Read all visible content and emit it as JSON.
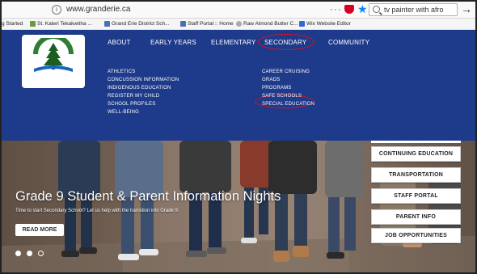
{
  "browser": {
    "url": "www.granderie.ca",
    "search_query": "tv painter with afro",
    "more_dots": "···"
  },
  "bookmarks": [
    {
      "label": "g Started",
      "color": ""
    },
    {
      "label": "St. Kateri Tekakwitha ...",
      "color": "#6a9a3a"
    },
    {
      "label": "Grand Erie District Sch...",
      "color": "#4a6fb3"
    },
    {
      "label": "Staff Portal :: Home",
      "color": "#4a6fb3"
    },
    {
      "label": "Raw Almond Butter C...",
      "color": "#aaaaaa"
    },
    {
      "label": "Wix Website Editor",
      "color": "#2a6bd6"
    }
  ],
  "nav": {
    "about": "ABOUT",
    "early_years": "EARLY YEARS",
    "elementary": "ELEMENTARY",
    "secondary": "SECONDARY",
    "community": "COMMUNITY"
  },
  "submenu_left": [
    "ATHLETICS",
    "CONCUSSION INFORMATION",
    "INDIGENOUS EDUCATION",
    "REGISTER MY CHILD",
    "SCHOOL PROFILES",
    "WELL-BEING"
  ],
  "submenu_right": [
    "CAREER CRUISING",
    "GRADS",
    "PROGRAMS",
    "SAFE SCHOOLS",
    "SPECIAL EDUCATION"
  ],
  "hero": {
    "title": "Grade 9 Student & Parent Information Nights",
    "subtitle": "Time to start Secondary School? Let us help with the transition into Grade 9.",
    "read_more": "READ MORE"
  },
  "side_buttons": [
    "CONTINUING EDUCATION",
    "TRANSPORTATION",
    "STAFF PORTAL",
    "PARENT INFO",
    "JOB OPPORTUNITIES"
  ],
  "colors": {
    "header_blue": "#1e3a8a",
    "annotation_red": "#e0101c"
  }
}
